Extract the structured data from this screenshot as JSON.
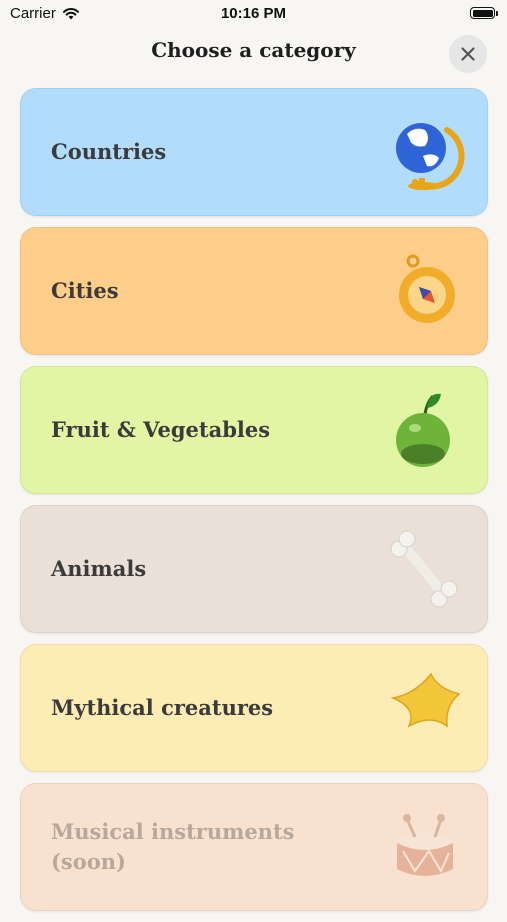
{
  "status_bar": {
    "carrier": "Carrier",
    "time": "10:16 PM"
  },
  "header": {
    "title": "Choose a category",
    "close_icon": "close-icon"
  },
  "categories": [
    {
      "label": "Countries",
      "icon": "globe-icon",
      "color": "#b2dcfb"
    },
    {
      "label": "Cities",
      "icon": "compass-icon",
      "color": "#fdcd8a"
    },
    {
      "label": "Fruit & Vegetables",
      "icon": "apple-icon",
      "color": "#e1f5a4"
    },
    {
      "label": "Animals",
      "icon": "bone-icon",
      "color": "#eae0d7"
    },
    {
      "label": "Mythical creatures",
      "icon": "star-icon",
      "color": "#fdedb5"
    },
    {
      "label": "Musical instruments (soon)",
      "icon": "drum-icon",
      "color": "#f8e1cf"
    }
  ]
}
